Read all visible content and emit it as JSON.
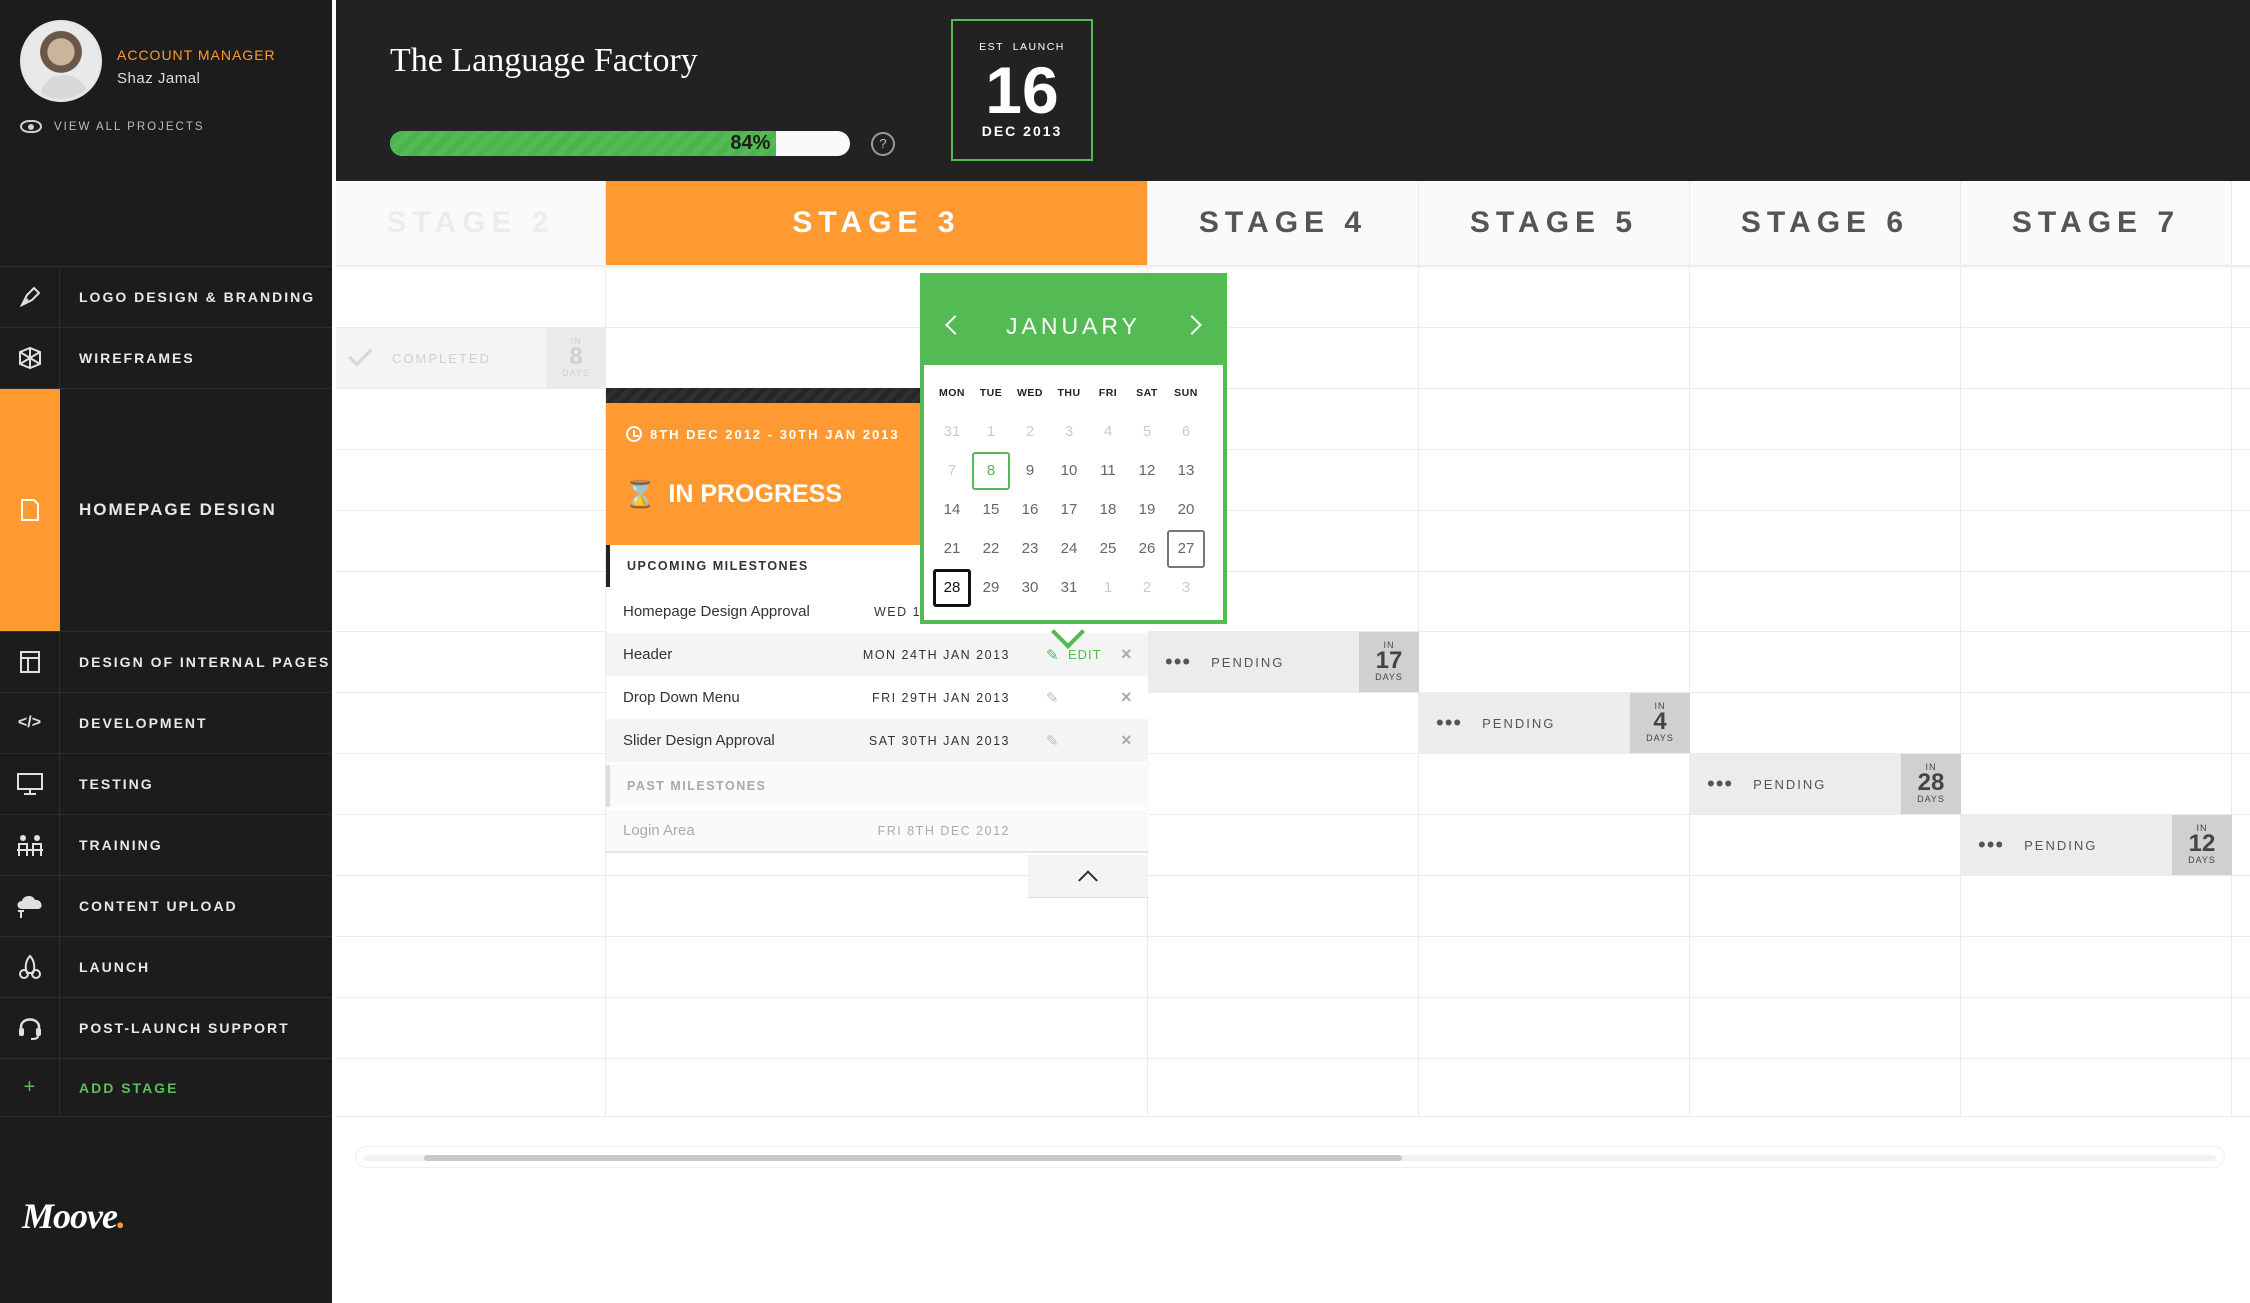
{
  "account": {
    "role": "ACCOUNT MANAGER",
    "name": "Shaz Jamal",
    "view_all": "VIEW ALL PROJECTS"
  },
  "project": {
    "title": "The Language Factory",
    "progress": 84,
    "progress_label": "84%",
    "help": "?",
    "launch": {
      "label": "EST  LAUNCH",
      "day": "16",
      "month": "DEC 2013"
    }
  },
  "nav": [
    {
      "label": "LOGO DESIGN & BRANDING",
      "icon": "pen-nib-icon"
    },
    {
      "label": "WIREFRAMES",
      "icon": "wireframe-cube-icon"
    },
    {
      "label": "HOMEPAGE DESIGN",
      "icon": "document-icon",
      "active": true
    },
    {
      "label": "DESIGN OF INTERNAL PAGES",
      "icon": "layout-icon"
    },
    {
      "label": "DEVELOPMENT",
      "icon": "code-icon"
    },
    {
      "label": "TESTING",
      "icon": "monitor-icon"
    },
    {
      "label": "TRAINING",
      "icon": "training-icon"
    },
    {
      "label": "CONTENT UPLOAD",
      "icon": "cloud-upload-icon"
    },
    {
      "label": "LAUNCH",
      "icon": "rocket-icon"
    },
    {
      "label": "POST-LAUNCH SUPPORT",
      "icon": "headset-icon"
    }
  ],
  "add_stage": {
    "icon": "+",
    "label": "ADD STAGE"
  },
  "brand": {
    "name": "Moove",
    "dot": "."
  },
  "stages": [
    "STAGE 2",
    "STAGE 3",
    "STAGE 4",
    "STAGE 5",
    "STAGE 6",
    "STAGE 7"
  ],
  "completed": {
    "label": "COMPLETED",
    "in": "IN",
    "days": "8",
    "unit": "DAYS"
  },
  "pending": [
    {
      "label": "PENDING",
      "in": "IN",
      "days": "17",
      "unit": "DAYS"
    },
    {
      "label": "PENDING",
      "in": "IN",
      "days": "4",
      "unit": "DAYS"
    },
    {
      "label": "PENDING",
      "in": "IN",
      "days": "28",
      "unit": "DAYS"
    },
    {
      "label": "PENDING",
      "in": "IN",
      "days": "12",
      "unit": "DAYS"
    }
  ],
  "panel": {
    "date_range": "8TH DEC 2012 - 30TH JAN 2013",
    "status": "IN PROGRESS",
    "upcoming_title": "UPCOMING MILESTONES",
    "past_title": "PAST MILESTONES",
    "edit_label": "EDIT",
    "upcoming": [
      {
        "name": "Homepage Design Approval",
        "date": "WED 16"
      },
      {
        "name": "Header",
        "date": "MON 24TH JAN 2013"
      },
      {
        "name": "Drop Down Menu",
        "date": "FRI 29TH JAN 2013"
      },
      {
        "name": "Slider Design Approval",
        "date": "SAT 30TH JAN 2013"
      }
    ],
    "past": [
      {
        "name": "Login Area",
        "date": "FRI 8TH DEC 2012"
      }
    ]
  },
  "calendar": {
    "month": "JANUARY",
    "dow": [
      "MON",
      "TUE",
      "WED",
      "THU",
      "FRI",
      "SAT",
      "SUN"
    ],
    "weeks": [
      [
        "31",
        "1",
        "2",
        "3",
        "4",
        "5",
        "6"
      ],
      [
        "7",
        "8",
        "9",
        "10",
        "11",
        "12",
        "13"
      ],
      [
        "14",
        "15",
        "16",
        "17",
        "18",
        "19",
        "20"
      ],
      [
        "21",
        "22",
        "23",
        "24",
        "25",
        "26",
        "27"
      ],
      [
        "28",
        "29",
        "30",
        "31",
        "1",
        "2",
        "3"
      ]
    ]
  },
  "colors": {
    "accent": "#fe9a31",
    "green": "#54bb54",
    "sidebar": "#1c1c1c",
    "header": "#222222"
  }
}
